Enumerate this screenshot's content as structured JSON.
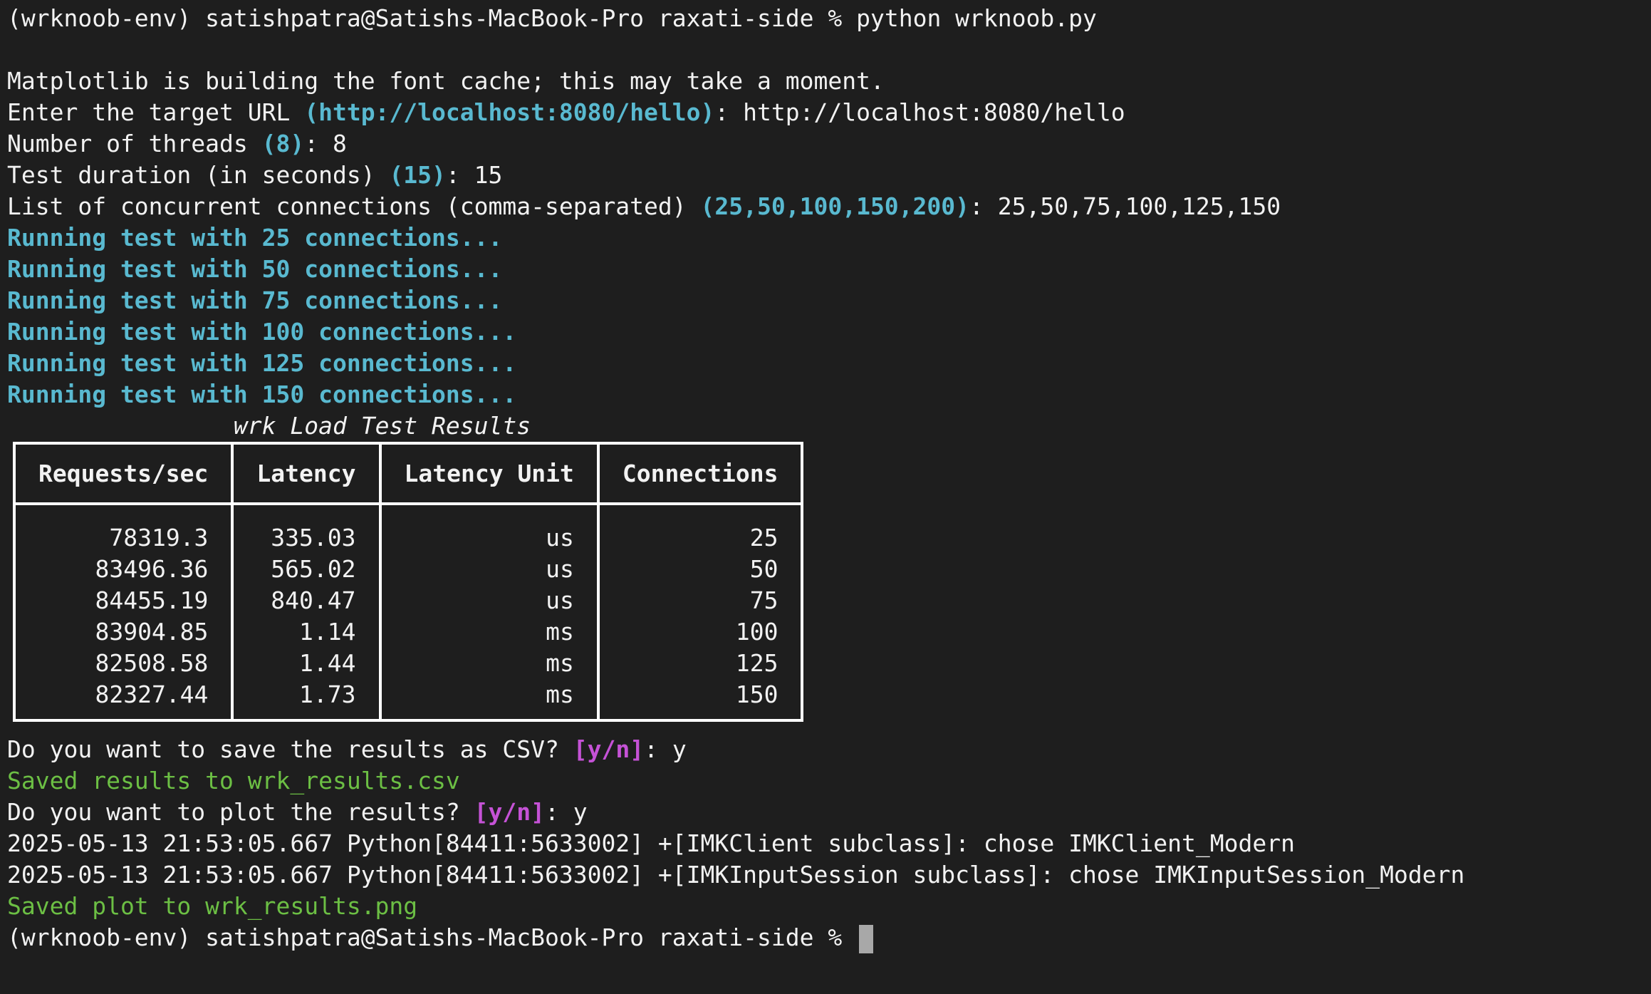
{
  "colors": {
    "background": "#1e1e1e",
    "text": "#f2f2f2",
    "default_value": "#59b9d0",
    "prompt_choice": "#c552d6",
    "success": "#6cbf44"
  },
  "prompt": {
    "env": "(wrknoob-env)",
    "user_host": "satishpatra@Satishs-MacBook-Pro",
    "dir": "raxati-side",
    "symbol": "%",
    "command": "python wrknoob.py"
  },
  "output": {
    "font_cache": "Matplotlib is building the font cache; this may take a moment.",
    "url_q": {
      "label": "Enter the target URL",
      "default": "(http://localhost:8080/hello)",
      "answer": "http://localhost:8080/hello"
    },
    "threads_q": {
      "label": "Number of threads",
      "default": "(8)",
      "answer": "8"
    },
    "duration_q": {
      "label": "Test duration (in seconds)",
      "default": "(15)",
      "answer": "15"
    },
    "connections_q": {
      "label": "List of concurrent connections (comma-separated)",
      "default": "(25,50,100,150,200)",
      "answer": "25,50,75,100,125,150"
    },
    "running": [
      "Running test with 25 connections...",
      "Running test with 50 connections...",
      "Running test with 75 connections...",
      "Running test with 100 connections...",
      "Running test with 125 connections...",
      "Running test with 150 connections..."
    ],
    "table_title": "wrk Load Test Results",
    "table": {
      "headers": [
        "Requests/sec",
        "Latency",
        "Latency Unit",
        "Connections"
      ],
      "rows": [
        [
          "78319.3",
          "335.03",
          "us",
          "25"
        ],
        [
          "83496.36",
          "565.02",
          "us",
          "50"
        ],
        [
          "84455.19",
          "840.47",
          "us",
          "75"
        ],
        [
          "83904.85",
          "1.14",
          "ms",
          "100"
        ],
        [
          "82508.58",
          "1.44",
          "ms",
          "125"
        ],
        [
          "82327.44",
          "1.73",
          "ms",
          "150"
        ]
      ]
    },
    "csv_q": {
      "label": "Do you want to save the results as CSV?",
      "choice": "[y/n]",
      "answer": "y"
    },
    "csv_saved": "Saved results to wrk_results.csv",
    "plot_q": {
      "label": "Do you want to plot the results?",
      "choice": "[y/n]",
      "answer": "y"
    },
    "log1": "2025-05-13 21:53:05.667 Python[84411:5633002] +[IMKClient subclass]: chose IMKClient_Modern",
    "log2": "2025-05-13 21:53:05.667 Python[84411:5633002] +[IMKInputSession subclass]: chose IMKInputSession_Modern",
    "plot_saved": "Saved plot to wrk_results.png"
  }
}
